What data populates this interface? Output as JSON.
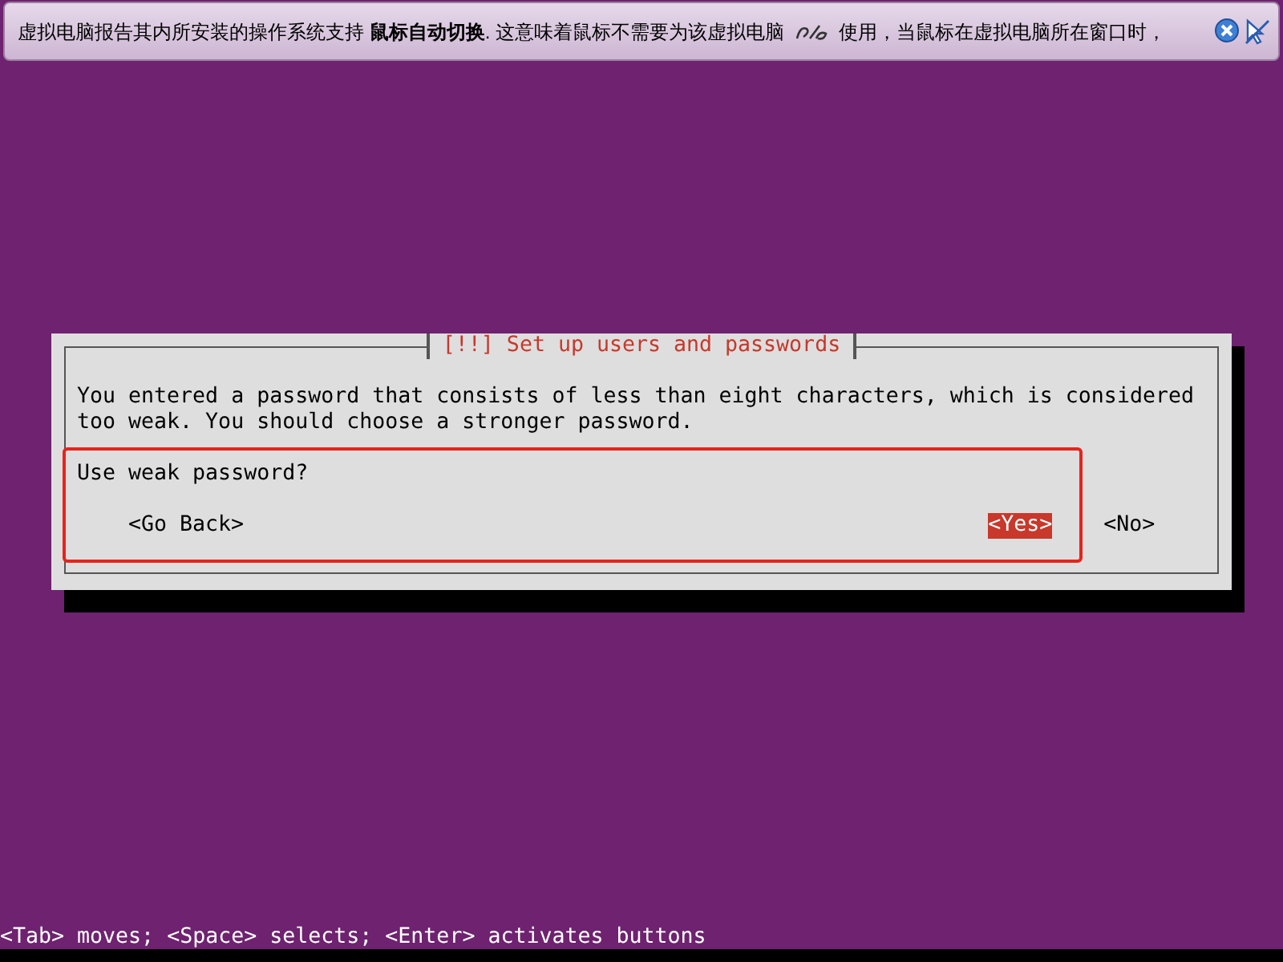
{
  "notification": {
    "text": "虚拟电脑报告其内所安装的操作系统支持 **鼠标自动切换**. 这意味着鼠标不需要为该虚拟电脑",
    "text_after": "使用，当鼠标在虚拟电脑所在窗口时，"
  },
  "dialog": {
    "title": "[!!] Set up users and passwords",
    "message": "You entered a password that consists of less than eight characters, which is considered too weak. You should choose a stronger password.",
    "question": "Use weak password?",
    "buttons": [
      {
        "label": "<Go Back>",
        "selected": false
      },
      {
        "label": "<Yes>",
        "selected": true
      },
      {
        "label": "<No>",
        "selected": false
      }
    ]
  },
  "status_bar": "<Tab> moves; <Space> selects; <Enter> activates buttons"
}
